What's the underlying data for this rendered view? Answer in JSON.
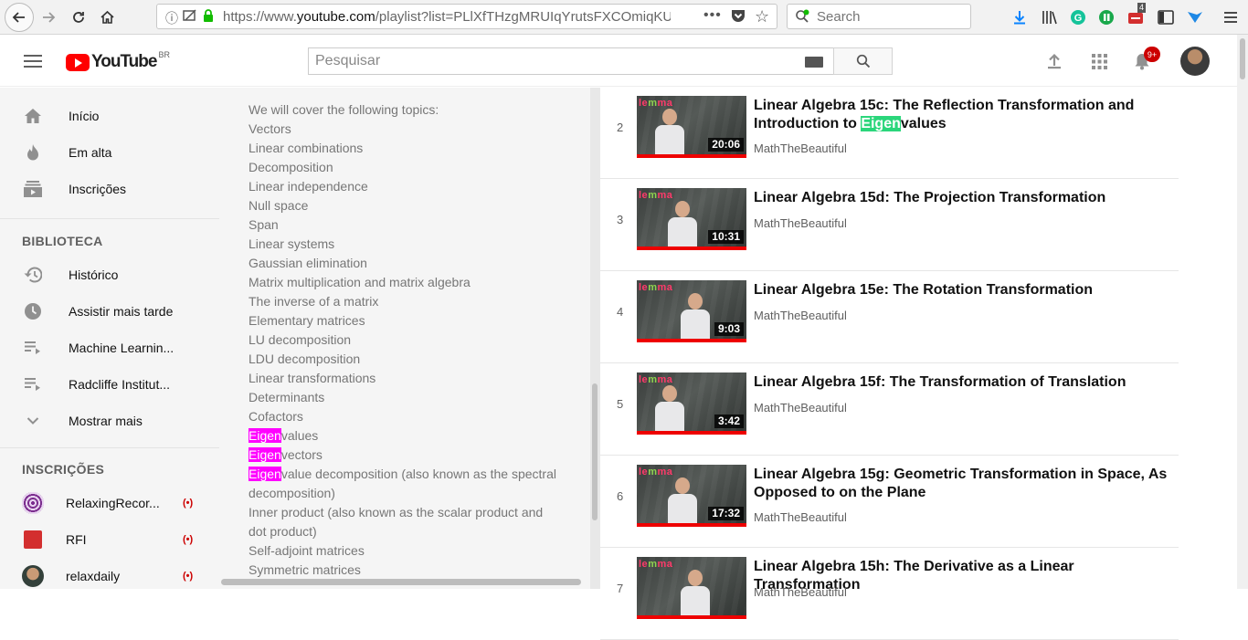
{
  "browser": {
    "url_prefix": "https://www.",
    "url_domain": "youtube.com",
    "url_rest": "/playlist?list=PLlXfTHzgMRUIqYrutsFXCOmiqKUgO",
    "search_placeholder": "Search",
    "library_badge": "4",
    "icons": [
      "back-icon",
      "forward-icon",
      "reload-icon",
      "home-icon",
      "info-icon",
      "tracking-icon",
      "lock-icon",
      "more-icon",
      "pocket-icon",
      "star-icon",
      "download-icon",
      "library-icon",
      "grammarly-icon",
      "extension-icon",
      "sidebar-icon",
      "menu-icon"
    ]
  },
  "masthead": {
    "logo": "YouTube",
    "region": "BR",
    "search_placeholder": "Pesquisar",
    "notifications_badge": "9+",
    "colors": {
      "brand": "#ff0000",
      "badge": "#cc0000"
    }
  },
  "sidebar": {
    "main_items": [
      {
        "label": "Início",
        "icon": "home-icon"
      },
      {
        "label": "Em alta",
        "icon": "trending-icon"
      },
      {
        "label": "Inscrições",
        "icon": "subscriptions-icon"
      }
    ],
    "library_heading": "BIBLIOTECA",
    "library_items": [
      {
        "label": "Histórico",
        "icon": "history-icon"
      },
      {
        "label": "Assistir mais tarde",
        "icon": "watch-later-icon"
      },
      {
        "label": "Machine Learnin...",
        "icon": "playlist-icon"
      },
      {
        "label": "Radcliffe Institut...",
        "icon": "playlist-icon"
      },
      {
        "label": "Mostrar mais",
        "icon": "chevron-down-icon"
      }
    ],
    "subs_heading": "INSCRIÇÕES",
    "subscriptions": [
      {
        "label": "RelaxingRecor...",
        "live": "(•)"
      },
      {
        "label": "RFI",
        "live": "(•)"
      },
      {
        "label": "relaxdaily",
        "live": "(•)"
      }
    ]
  },
  "description": {
    "lines": [
      {
        "pre": "",
        "hl": "",
        "post": "We will cover the following topics:"
      },
      {
        "pre": "",
        "hl": "",
        "post": "Vectors"
      },
      {
        "pre": "",
        "hl": "",
        "post": "Linear combinations"
      },
      {
        "pre": "",
        "hl": "",
        "post": "Decomposition"
      },
      {
        "pre": "",
        "hl": "",
        "post": "Linear independence"
      },
      {
        "pre": "",
        "hl": "",
        "post": "Null space"
      },
      {
        "pre": "",
        "hl": "",
        "post": "Span"
      },
      {
        "pre": "",
        "hl": "",
        "post": "Linear systems"
      },
      {
        "pre": "",
        "hl": "",
        "post": "Gaussian elimination"
      },
      {
        "pre": "",
        "hl": "",
        "post": "Matrix multiplication and matrix algebra"
      },
      {
        "pre": "",
        "hl": "",
        "post": "The inverse of a matrix"
      },
      {
        "pre": "",
        "hl": "",
        "post": "Elementary matrices"
      },
      {
        "pre": "",
        "hl": "",
        "post": "LU decomposition"
      },
      {
        "pre": "",
        "hl": "",
        "post": "LDU decomposition"
      },
      {
        "pre": "",
        "hl": "",
        "post": "Linear transformations"
      },
      {
        "pre": "",
        "hl": "",
        "post": "Determinants"
      },
      {
        "pre": "",
        "hl": "",
        "post": "Cofactors"
      },
      {
        "pre": "",
        "hl": "Eigen",
        "post": "values"
      },
      {
        "pre": "",
        "hl": "Eigen",
        "post": "vectors"
      },
      {
        "pre": "",
        "hl": "Eigen",
        "post": "value decomposition (also known as the spectral"
      },
      {
        "pre": "",
        "hl": "",
        "post": "decomposition)"
      },
      {
        "pre": "",
        "hl": "",
        "post": "Inner product (also known as the scalar product and"
      },
      {
        "pre": "",
        "hl": "",
        "post": "dot product)"
      },
      {
        "pre": "",
        "hl": "",
        "post": "Self-adjoint matrices"
      },
      {
        "pre": "",
        "hl": "",
        "post": "Symmetric matrices"
      }
    ]
  },
  "playlist": {
    "videos": [
      {
        "index": "2",
        "title_pre": "Linear Algebra 15c: The Reflection Transformation and Introduction to ",
        "title_hl": "Eigen",
        "title_post": "values",
        "channel": "MathTheBeautiful",
        "duration": "20:06"
      },
      {
        "index": "3",
        "title_pre": "Linear Algebra 15d: The Projection Transformation",
        "title_hl": "",
        "title_post": "",
        "channel": "MathTheBeautiful",
        "duration": "10:31"
      },
      {
        "index": "4",
        "title_pre": "Linear Algebra 15e: The Rotation Transformation",
        "title_hl": "",
        "title_post": "",
        "channel": "MathTheBeautiful",
        "duration": "9:03"
      },
      {
        "index": "5",
        "title_pre": "Linear Algebra 15f: The Transformation of Translation",
        "title_hl": "",
        "title_post": "",
        "channel": "MathTheBeautiful",
        "duration": "3:42"
      },
      {
        "index": "6",
        "title_pre": "Linear Algebra 15g: Geometric Transformation in Space, As Opposed to on the Plane",
        "title_hl": "",
        "title_post": "",
        "channel": "MathTheBeautiful",
        "duration": "17:32"
      },
      {
        "index": "7",
        "title_pre": "Linear Algebra 15h: The Derivative as a Linear Transformation",
        "title_hl": "",
        "title_post": "",
        "channel": "MathTheBeautiful",
        "duration": ""
      }
    ],
    "thumb_brand_a": "le",
    "thumb_brand_b": "m",
    "thumb_brand_c": "ma"
  }
}
